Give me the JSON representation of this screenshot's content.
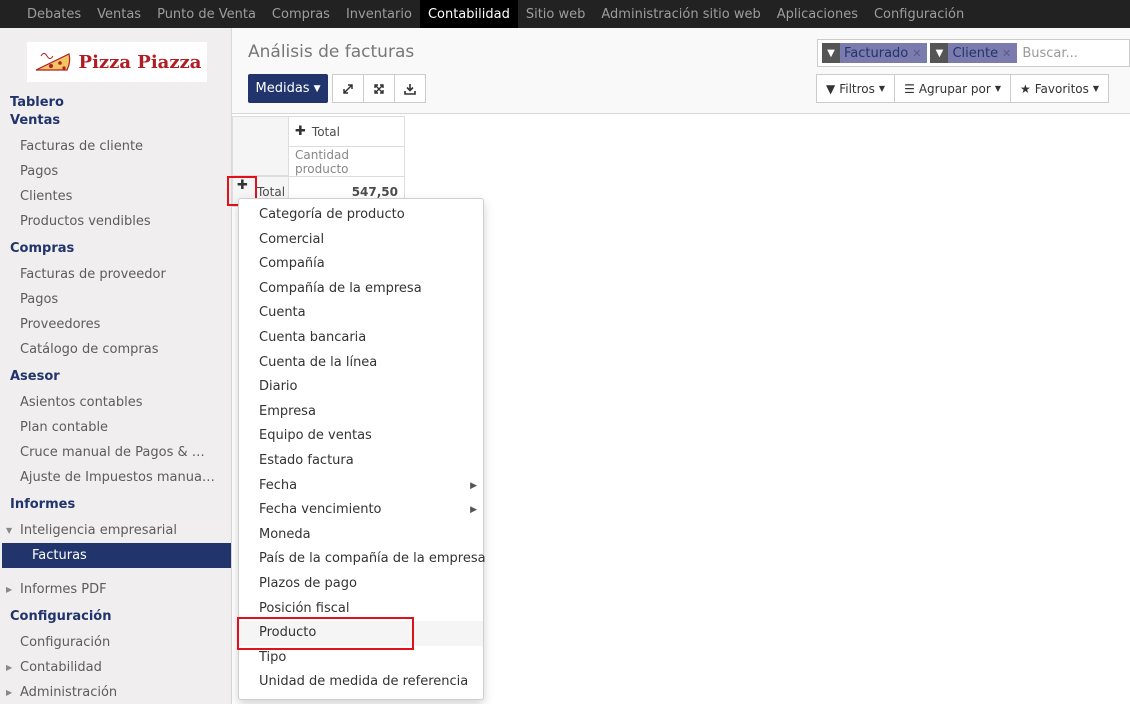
{
  "topbar": {
    "menus": [
      "Debates",
      "Ventas",
      "Punto de Venta",
      "Compras",
      "Inventario",
      "Contabilidad",
      "Sitio web",
      "Administración sitio web",
      "Aplicaciones",
      "Configuración"
    ],
    "active": "Contabilidad"
  },
  "brand": {
    "name": "Pizza Piazza"
  },
  "sidebar": {
    "tablero": "Tablero",
    "ventas": {
      "title": "Ventas",
      "items": [
        "Facturas de cliente",
        "Pagos",
        "Clientes",
        "Productos vendibles"
      ]
    },
    "compras": {
      "title": "Compras",
      "items": [
        "Facturas de proveedor",
        "Pagos",
        "Proveedores",
        "Catálogo de compras"
      ]
    },
    "asesor": {
      "title": "Asesor",
      "items": [
        "Asientos contables",
        "Plan contable",
        "Cruce manual de Pagos & …",
        "Ajuste de Impuestos manua…"
      ]
    },
    "informes": {
      "title": "Informes",
      "items": [
        "Inteligencia empresarial",
        "Facturas",
        "Informes PDF"
      ]
    },
    "configuracion": {
      "title": "Configuración",
      "items": [
        "Configuración",
        "Contabilidad",
        "Administración"
      ]
    }
  },
  "main": {
    "title": "Análisis de facturas",
    "measures_label": "Medidas",
    "search": {
      "facets": [
        "Facturado",
        "Cliente"
      ],
      "placeholder": "Buscar..."
    },
    "filters_label": "Filtros",
    "groupby_label": "Agrupar por",
    "favorites_label": "Favoritos"
  },
  "pivot": {
    "col_header": "Total",
    "measure": "Cantidad producto",
    "row_header": "Total",
    "value": "547,50"
  },
  "dropdown": {
    "items": [
      "Categoría de producto",
      "Comercial",
      "Compañía",
      "Compañía de la empresa",
      "Cuenta",
      "Cuenta bancaria",
      "Cuenta de la línea",
      "Diario",
      "Empresa",
      "Equipo de ventas",
      "Estado factura",
      "Fecha",
      "Fecha vencimiento",
      "Moneda",
      "País de la compañía de la empresa",
      "Plazos de pago",
      "Posición fiscal",
      "Producto",
      "Tipo",
      "Unidad de medida de referencia"
    ],
    "hovered": "Producto"
  },
  "icons": {
    "expand": "expand-icon",
    "collapse": "arrows-icon",
    "download": "download-icon",
    "filter": "filter-icon",
    "list": "list-icon",
    "star": "star-icon"
  },
  "colors": {
    "accent": "#21346b",
    "highlight": "#e0111b",
    "brand": "#b01e23"
  }
}
